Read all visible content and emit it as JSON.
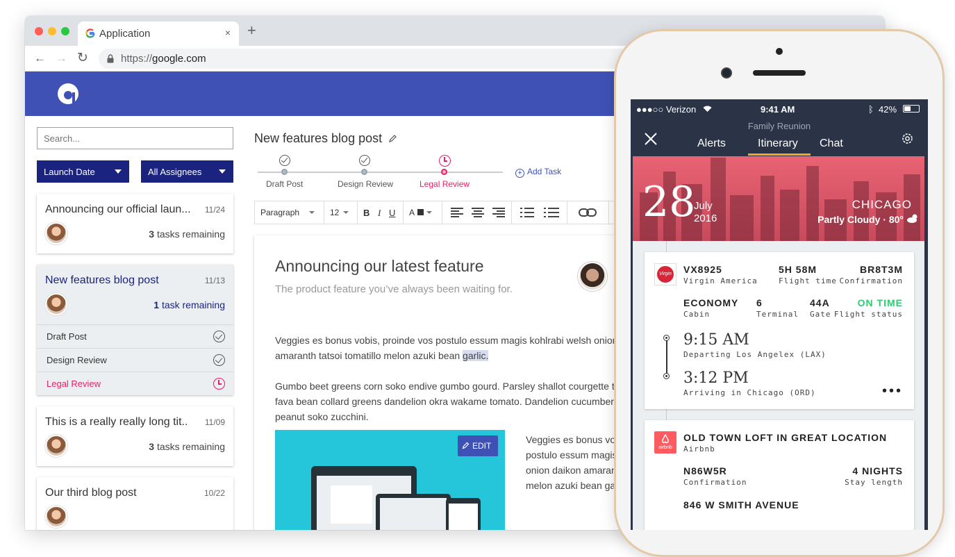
{
  "browser": {
    "tab_title": "Application",
    "tab_close": "×",
    "new_tab": "+",
    "url_scheme": "https://",
    "url_host": "google.com",
    "back": "←",
    "forward": "→",
    "reload": "↻",
    "brand_color": "#3f51b5"
  },
  "sidebar": {
    "search_placeholder": "Search...",
    "filter_date": "Launch Date",
    "filter_assignees": "All Assignees",
    "cards": [
      {
        "title": "Announcing our official laun...",
        "date": "11/24",
        "count": "3",
        "tasks": " tasks remaining"
      },
      {
        "title": "New features blog post",
        "date": "11/13",
        "count": "1",
        "tasks": " task remaining"
      },
      {
        "title": "This is a really really long tit..",
        "date": "11/09",
        "count": "3",
        "tasks": " tasks remaining"
      },
      {
        "title": "Our third blog post",
        "date": "10/22"
      }
    ],
    "subtasks": [
      "Draft Post",
      "Design Review",
      "Legal Review"
    ]
  },
  "main": {
    "title": "New features blog post",
    "steps": [
      "Draft Post",
      "Design Review",
      "Legal Review"
    ],
    "add_task": "Add Task",
    "toolbar": {
      "block": "Paragraph",
      "size": "12",
      "bold": "B",
      "italic": "I",
      "underline": "U",
      "color": "A"
    },
    "editor": {
      "heading": "Announcing our latest feature",
      "subheading": "The product feature you’ve always been waiting for.",
      "p1a": "Veggies es bonus vobis, proinde vos postulo essum magis kohlrabi welsh onion",
      "p1b": "amaranth tatsoi tomatillo melon azuki bean ",
      "p1c": "garlic.",
      "p2a": "Gumbo beet greens corn soko endive gumbo gourd. Parsley shallot courgette tatsoi",
      "p2b": "fava bean collard greens dandelion okra wakame tomato. Dandelion cucumber earthnut",
      "p2c": "peanut soko zucchini.",
      "edit": "EDIT",
      "side": [
        "Veggies es bonus vobis",
        "postulo essum magis",
        "onion daikon amaranth",
        "melon azuki bean garlic"
      ]
    }
  },
  "phone": {
    "carrier": "●●●○○ Verizon",
    "time": "9:41 AM",
    "battery": "42%",
    "event": "Family Reunion",
    "tabs": [
      "Alerts",
      "Itinerary",
      "Chat"
    ],
    "day": "28",
    "month": "July",
    "year": "2016",
    "city": "CHICAGO",
    "weather": "Partly Cloudy · 80°",
    "flight": {
      "number": "VX8925",
      "airline": "Virgin America",
      "duration": "5H 58M",
      "duration_label": "Flight time",
      "confirmation": "BR8T3M",
      "confirmation_label": "Confirmation",
      "class": "ECONOMY",
      "class_label": "Cabin",
      "terminal": "6",
      "terminal_label": "Terminal",
      "gate": "44A",
      "gate_label": "Gate",
      "status": "ON TIME",
      "status_label": "Flight status",
      "depart_time": "9:15 AM",
      "depart_place": "Departing Los Angelex (LAX)",
      "arrive_time": "3:12 PM",
      "arrive_place": "Arriving in Chicago (ORD)",
      "airline_logo": "Virgin"
    },
    "stay": {
      "name": "OLD TOWN LOFT IN GREAT LOCATION",
      "host": "Airbnb",
      "code": "N86W5R",
      "code_label": "Confirmation",
      "nights": "4 NIGHTS",
      "nights_label": "Stay length",
      "address": "846 W SMITH AVENUE",
      "logo": "airbnb"
    }
  }
}
